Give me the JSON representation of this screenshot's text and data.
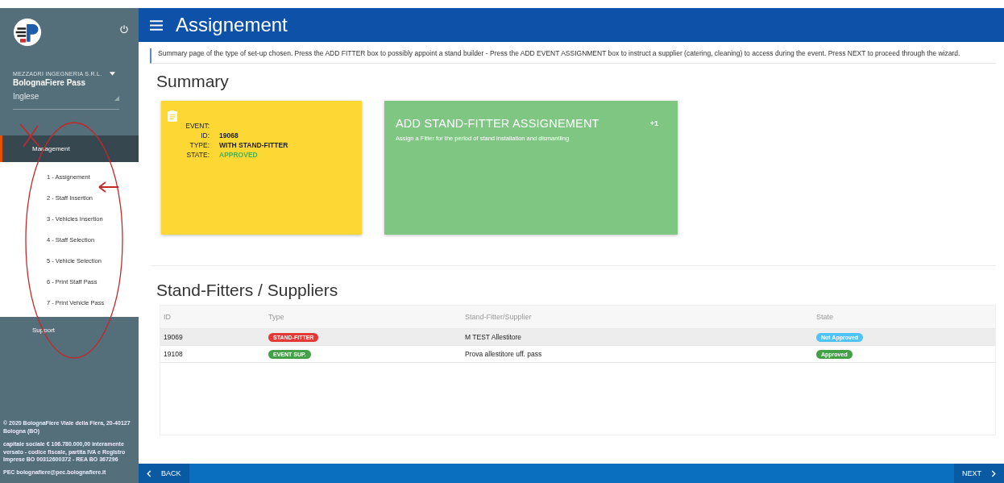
{
  "sidebar": {
    "company": "MEZZADRI INGEGNERIA S.R.L.",
    "app_name": "BolognaFiere Pass",
    "language": "Inglese",
    "items": [
      {
        "label": "Management",
        "expanded": true,
        "children": [
          {
            "label": "1 - Assignement"
          },
          {
            "label": "2 - Staff Insertion"
          },
          {
            "label": "3 - Vehicles Insertion"
          },
          {
            "label": "4 - Staff Selection"
          },
          {
            "label": "5 - Vehicle Selection"
          },
          {
            "label": "6 - Print Staff Pass"
          },
          {
            "label": "7 - Print Vehicle Pass"
          }
        ]
      },
      {
        "label": "Support",
        "expanded": false
      }
    ],
    "footer": [
      "© 2020 BolognaFiere Viale della Fiera, 20-40127 Bologna (BO)",
      "capitale sociale € 106.780.000,00 interamente versato - codice fiscale, partita IVA e Registro Imprese BO 00312600372 - REA BO 367296",
      "PEC bolognafiere@pec.bolognafiere.it"
    ]
  },
  "header": {
    "title": "Assignement"
  },
  "info": "Summary page of the type of set-up chosen. Press the ADD FITTER box to possibly appoint a stand builder - Press the ADD EVENT ASSIGNMENT box to instruct a supplier (catering, cleaning) to access during the event. Press NEXT to proceed through the wizard.",
  "summary": {
    "heading": "Summary",
    "event_card": {
      "fields": [
        {
          "label": "EVENT:"
        },
        {
          "label": "ID:",
          "value": "19068"
        },
        {
          "label": "TYPE:",
          "value": "WITH STAND-FITTER"
        },
        {
          "label": "STATE:",
          "value": "APPROVED",
          "color": "#4caf50"
        }
      ]
    },
    "action_card": {
      "title": "ADD STAND-FITTER ASSIGNEMENT",
      "badge": "+1",
      "text": "Assign a Fitter for the period of stand installation and dismantling"
    }
  },
  "suppliers": {
    "heading": "Stand-Fitters / Suppliers",
    "columns": [
      "ID",
      "Type",
      "Stand-Fitter/Supplier",
      "State"
    ],
    "rows": [
      {
        "id": "19069",
        "type": {
          "label": "STAND-FITTER",
          "color": "#e53935"
        },
        "name": "M TEST Allestitore",
        "state": {
          "label": "Not Approved",
          "color": "#4fc3f7"
        },
        "selected": true
      },
      {
        "id": "19108",
        "type": {
          "label": "EVENT SUP.",
          "color": "#43a047"
        },
        "name": "Prova allestitore uff. pass",
        "state": {
          "label": "Approved",
          "color": "#43a047"
        },
        "selected": false
      }
    ]
  },
  "footer_bar": {
    "back": "BACK",
    "next": "NEXT"
  }
}
